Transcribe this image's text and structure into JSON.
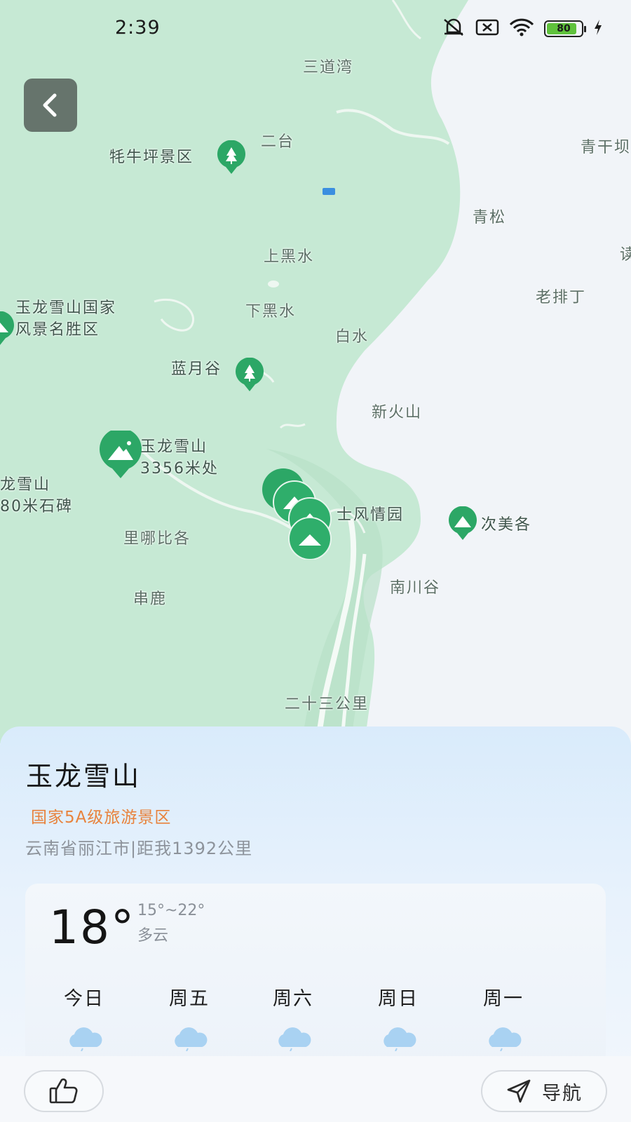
{
  "status_bar": {
    "time": "2:39",
    "battery_level": "80"
  },
  "map": {
    "labels": {
      "sandaowan": "三道湾",
      "ertai": "二台",
      "qinggan": "青干坝",
      "maoniuping": "牦牛坪景区",
      "qingsong": "青松",
      "shangheishui": "上黑水",
      "yulong_park": "玉龙雪山国家\n风景名胜区",
      "xiaheishui": "下黑水",
      "laopaiding": "老排丁",
      "baishui": "白水",
      "lanyuegu": "蓝月谷",
      "xinhuoshan": "新火山",
      "yulong_3356": "玉龙雪山\n3356米处",
      "yulong_stele": "龙雪山\n80米石碑",
      "fengqingyuan": "士风情园",
      "cimeige": "次美各",
      "linabige": "里哪比各",
      "nanchuangu": "南川谷",
      "chuanlu": "串鹿",
      "ershisan": "二十三公里",
      "edge_char": "读"
    }
  },
  "place": {
    "name": "玉龙雪山",
    "grade": "国家5A级旅游景区",
    "meta": "云南省丽江市|距我1392公里"
  },
  "weather": {
    "current_temp": "18°",
    "range": "15°~22°",
    "condition": "多云",
    "forecast": [
      {
        "day": "今日",
        "icon": "cloud-rain-icon"
      },
      {
        "day": "周五",
        "icon": "cloud-rain-icon"
      },
      {
        "day": "周六",
        "icon": "cloud-rain-icon"
      },
      {
        "day": "周日",
        "icon": "cloud-rain-icon"
      },
      {
        "day": "周一",
        "icon": "cloud-rain-icon"
      }
    ]
  },
  "actions": {
    "navigate_label": "导航"
  },
  "colors": {
    "map_green": "#c6e9d4",
    "pin_green": "#2ca766",
    "grade_orange": "#e8823c"
  }
}
